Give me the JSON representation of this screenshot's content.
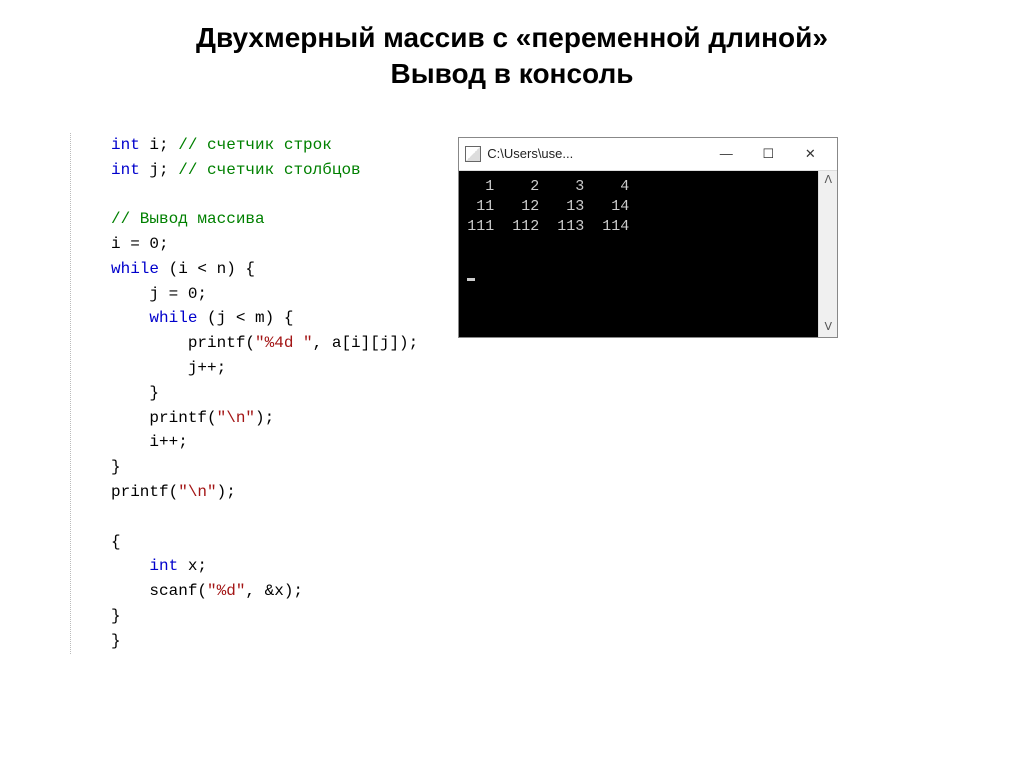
{
  "title_line1": "Двухмерный массив с «переменной длиной»",
  "title_line2": "Вывод в консоль",
  "code": {
    "kw_int1": "int",
    "var_i": " i; ",
    "cm_i": "// счетчик строк",
    "kw_int2": "int",
    "var_j": " j; ",
    "cm_j": "// счетчик столбцов",
    "cm_out": "// Вывод массива",
    "l_i0": "i = 0;",
    "kw_while1": "while",
    "l_wh1": " (i < n) {",
    "l_j0": "    j = 0;",
    "kw_while2": "while",
    "l_wh2_pre": "    ",
    "l_wh2": " (j < m) {",
    "l_printf1a": "        printf(",
    "str_fmt1": "\"%4d \"",
    "l_printf1b": ", a[i][j]);",
    "l_jpp": "        j++;",
    "l_close1": "    }",
    "l_printf2a": "    printf(",
    "str_nl1": "\"\\n\"",
    "l_printf2b": ");",
    "l_ipp": "    i++;",
    "l_close2": "}",
    "l_printf3a": "printf(",
    "str_nl2": "\"\\n\"",
    "l_printf3b": ");",
    "l_open3": "{",
    "kw_int3": "int",
    "l_intx": " x;",
    "l_intx_pre": "    ",
    "l_scanf_pre": "    ",
    "l_scanf_a": "scanf(",
    "str_fmt2": "\"%d\"",
    "l_scanf_b": ", &x);",
    "l_close3": "}",
    "l_close4": "}"
  },
  "console": {
    "path": "C:\\Users\\use...",
    "min": "—",
    "max": "☐",
    "close": "✕",
    "row1": "  1    2    3    4",
    "row2": " 11   12   13   14",
    "row3": "111  112  113  114",
    "scroll_up": "ᐱ",
    "scroll_down": "ᐯ"
  }
}
